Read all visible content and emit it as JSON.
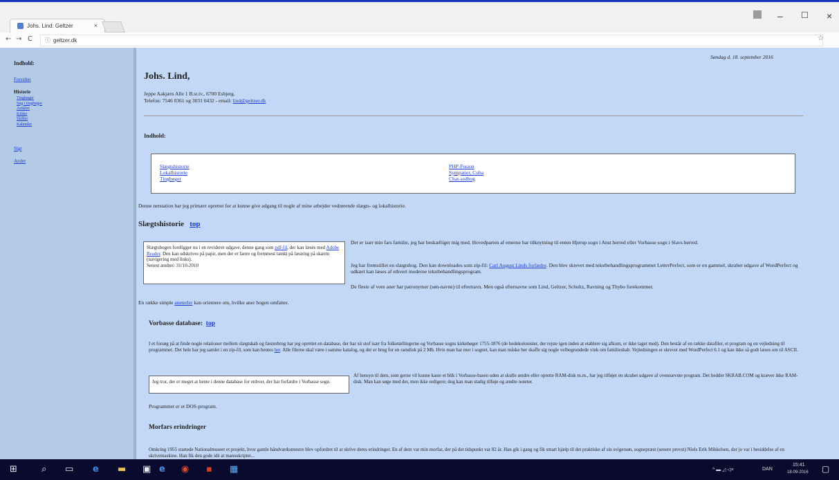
{
  "browser": {
    "tab_title": "Johs. Lind: Geltzer",
    "tab_close": "×",
    "minimize": "–",
    "maximize": "☐",
    "close": "×",
    "back": "←",
    "forward": "→",
    "reload": "C",
    "url_icon": "ⓘ",
    "url": "geltzer.dk",
    "bookmark": "☆"
  },
  "sidebar": {
    "heading": "Indhold:",
    "link1": "Forsiden",
    "section": "Historie",
    "items": [
      "Tingbøger",
      "Søg i tingbøger",
      "Artikler",
      "Kilder",
      "Skifter",
      "Kalender"
    ],
    "link_bottom1": "Slgt",
    "link_bottom2": "Andet"
  },
  "main": {
    "date": "Søndag d. 18. september 2016",
    "title": "Johs. Lind,",
    "address": "Jeppe Aakjærs Alle 1 B.st.tv., 6700 Esbjerg.",
    "phone_prefix": "Telefon: 7546 0361 og 3031 0432 - email:",
    "email": "lind@geltzer.dk",
    "indhold_heading": "Indhold:",
    "toc_left": [
      "Slægtshistorie",
      "Lokalhistorie",
      "Tingbøger"
    ],
    "toc_right": [
      "PHP-Fusion",
      "Sympatier, Cuba",
      "Chat-sedbog"
    ],
    "intro": "Denne netstation har jeg primært oprettet for at kunne give adgang til nogle af mine arbejder vedrørende slægts- og lokalhistorie.",
    "slaegt_heading": "Slægtshistorie",
    "top_link": "top",
    "box1_text1": "Slægtsbogen foreligger nu i en revideret udgave, denne gang som",
    "box1_link1": "pdf-fil",
    "box1_text2": ", der kan læses med",
    "box1_link2": "Adobe Reader",
    "box1_text3": ". Den kan udskrives på papir, men der er færre og fremmest tænkt på læsning på skærm (navigering med links).",
    "box1_date": "Senest ændret: 31/10-2010",
    "para1": "Det er især min fars familie, jeg har beskæftiget mig med. Hovedparten af emerne har tilknytning til enten Hjerup sogn i Anst herred eller Vorbasse sogn i Slavs herred.",
    "para2_text": "Jeg har fremstillet en slægtsbog. Den kan downloades som zip-fil:",
    "para2_link": "Carl August Linds forfædre",
    "para2_text2": ". Den blev skrevet med tekstbehandlingsprogrammet LetterPerfect, som er en gammel, skrabet udgave af WordPerfect og udkært kan læses af ethvert moderne tekstbehandlingsprogram.",
    "para3": "De fleste af vore aner har patronymer (søn-navne) til efternavn. Men også efternavne som Lind, Geltzer, Schultz, Ravning og Thybo forekommer.",
    "para4_text": "En række simple",
    "para4_link": "aneterler",
    "para4_text2": "kan orientere om, hvilke aner bogen omfatter.",
    "vorbasse_heading": "Vorbasse database:",
    "vorbasse_para": "I et forsøg på at finde nogle relationer mellem slægtskab og fæsterbrug har jeg oprettet en database, der har sit stof især fra folketællingerne og Vorbasse sogns kirkebøger 1755-1876 (de hedekolonister, der rejste igen inden at etablere sig afkom, er ikke taget med). Den består af en række datafiler, et program og en vejledning til programmet. Det hele har jeg samlet i en zip-fil, som kan hentes",
    "vorbasse_link": "her",
    "vorbasse_para2": ". Alle filerne skal være i samme katalog, og der er brug for en ramdisk på 2 Mb. Hvis man har mer i sognet, kan man måske her skaffe sig nogle velbegrundede vink om familieskab. Vejledningen er skrevet med WordPerfect 6.1 og kan ikke så godt læses om til ASCII.",
    "box2_text": "Jeg tror, der er meget at hente i denne database for enhver, der har forfædre i Vorbasse sogn.",
    "vorbasse_right": "Af hensyn til dem, som gerne vil kunne kaste et blik i Vorbasse-basen uden at skulle ændre eller oprette RAM-disk m.m., har jeg tilføjet en skrabet udgave af ovennævnte program. Det hedder SKRAB.COM og kræver ikke RAM-disk. Man kan søge med det, men ikke redigere; dog kan man stadig tilføje og ændre noteter.",
    "dos_text": "Programmet er et DOS-program.",
    "morfar_heading": "Morfars erindringer",
    "morfar_para": "Omkring 1955 startede Nationalmuseet et projekt, hvor gamle håndværksmestre blev opfordret til at skrive deres erindringer. En af dem var min morfar, der på det tidspunkt var 82 år. Han gik i gang og fik smart hjælp til det praktiske af sin svigersøn, sognepræst (senere provst) Niels Erik Mikkelsen, der jo var i besiddelse af en skrivemaskine. Han fik den gode idé at manuskriptet..."
  },
  "taskbar": {
    "tray_text": "DAN",
    "time": "15:41",
    "date": "18-09-2016"
  }
}
